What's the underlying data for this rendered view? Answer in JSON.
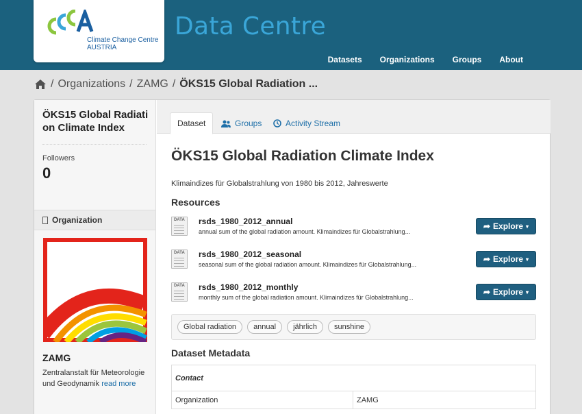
{
  "header": {
    "logo_text_line1": "Climate Change Centre",
    "logo_text_line2": "AUSTRIA",
    "site_title": "Data Centre",
    "nav": [
      "Datasets",
      "Organizations",
      "Groups",
      "About"
    ]
  },
  "breadcrumb": {
    "items": [
      "Organizations",
      "ZAMG"
    ],
    "active": "ÖKS15 Global Radiation ..."
  },
  "sidebar": {
    "title": "ÖKS15 Global Radiation Climate Index",
    "followers_label": "Followers",
    "followers_count": "0",
    "org_heading": "Organization",
    "org_name": "ZAMG",
    "org_description": "Zentralanstalt für Meteorologie und Geodynamik",
    "read_more": "read more"
  },
  "tabs": [
    {
      "label": "Dataset",
      "icon": "none",
      "active": true
    },
    {
      "label": "Groups",
      "icon": "users-icon",
      "active": false
    },
    {
      "label": "Activity Stream",
      "icon": "clock-icon",
      "active": false
    }
  ],
  "dataset": {
    "title": "ÖKS15 Global Radiation Climate Index",
    "notes": "Klimaindizes für Globalstrahlung von 1980 bis 2012, Jahreswerte",
    "resources_heading": "Resources",
    "resources": [
      {
        "name": "rsds_1980_2012_annual",
        "description": "annual sum of the global radiation amount. Klimaindizes für Globalstrahlung...",
        "format": "DATA",
        "button": "Explore"
      },
      {
        "name": "rsds_1980_2012_seasonal",
        "description": "seasonal sum of the global radiation amount. Klimaindizes für Globalstrahlung...",
        "format": "DATA",
        "button": "Explore"
      },
      {
        "name": "rsds_1980_2012_monthly",
        "description": "monthly sum of the global radiation amount. Klimaindizes für Globalstrahlung...",
        "format": "DATA",
        "button": "Explore"
      }
    ],
    "tags": [
      "Global radiation",
      "annual",
      "jährlich",
      "sunshine"
    ],
    "metadata_heading": "Dataset Metadata",
    "metadata_section": "Contact",
    "metadata_rows": [
      {
        "key": "Organization",
        "value": "ZAMG"
      }
    ]
  },
  "colors": {
    "header_bg": "#1b617e",
    "title_blue": "#3aa6d8",
    "button_bg": "#1f5f80",
    "link": "#1e6fa8"
  }
}
